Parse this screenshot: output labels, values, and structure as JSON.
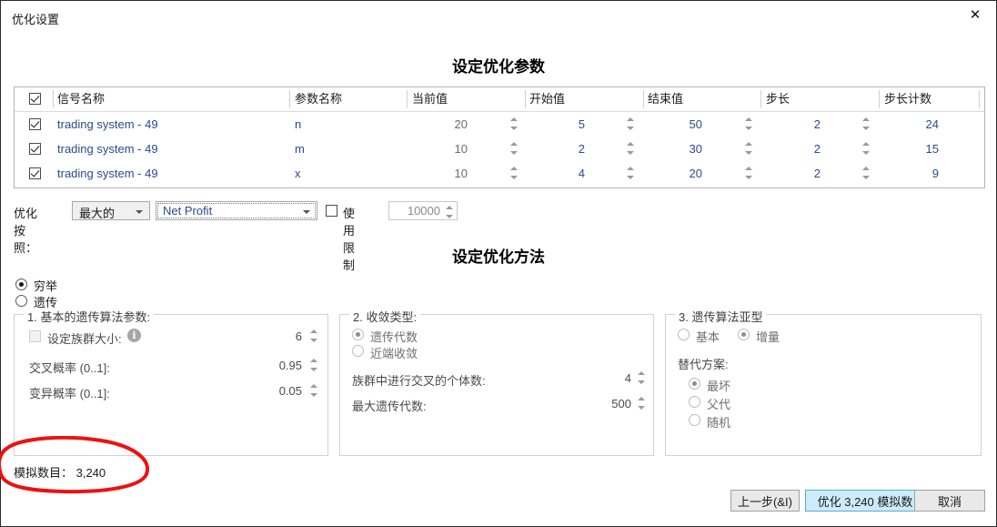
{
  "window": {
    "title": "优化设置",
    "close_icon": "close-icon"
  },
  "headings": {
    "params": "设定优化参数",
    "method": "设定优化方法"
  },
  "grid": {
    "columns": [
      "信号名称",
      "参数名称",
      "当前值",
      "开始值",
      "结束值",
      "步长",
      "步长计数"
    ],
    "rows": [
      {
        "checked": true,
        "signal": "trading system - 49",
        "param": "n",
        "current": "20",
        "start": "5",
        "end": "50",
        "step": "2",
        "count": "24"
      },
      {
        "checked": true,
        "signal": "trading system - 49",
        "param": "m",
        "current": "10",
        "start": "2",
        "end": "30",
        "step": "2",
        "count": "15"
      },
      {
        "checked": true,
        "signal": "trading system - 49",
        "param": "x",
        "current": "10",
        "start": "4",
        "end": "20",
        "step": "2",
        "count": "9"
      }
    ]
  },
  "optimize_by": {
    "label": "优化按照：",
    "direction": "最大的",
    "metric": "Net Profit",
    "limit_label": "使用限制",
    "limit_checked": false,
    "limit_value": "10000"
  },
  "method": {
    "exhaustive": "穷举",
    "genetic": "遗传",
    "selected": "穷举"
  },
  "group1": {
    "title": "1. 基本的遗传算法参数:",
    "population_label": "设定族群大小:",
    "population_value": "6",
    "info_icon": "info-icon",
    "crossover_label": "交叉概率 (0..1]:",
    "crossover_value": "0.95",
    "mutation_label": "变异概率 (0..1]:",
    "mutation_value": "0.05"
  },
  "group2": {
    "title": "2. 收敛类型:",
    "radio_generations": "遗传代数",
    "radio_proximity": "近端收敛",
    "selected": "遗传代数",
    "crossover_count_label": "族群中进行交叉的个体数:",
    "crossover_count_value": "4",
    "max_generations_label": "最大遗传代数:",
    "max_generations_value": "500"
  },
  "group3": {
    "title": "3. 遗传算法亚型",
    "radio_basic": "基本",
    "radio_incremental": "增量",
    "selected_subtype": "增量",
    "replacement_label": "替代方案:",
    "replacement_worst": "最坏",
    "replacement_parent": "父代",
    "replacement_random": "随机",
    "selected_replacement": "最坏"
  },
  "footer": {
    "count_label": "模拟数目：",
    "count_value": "3,240",
    "count_text": "模拟数目：  3,240",
    "back_button": "上一步(&I)",
    "optimize_button": "优化 3,240 模拟数",
    "cancel_button": "取消"
  },
  "annotation": {
    "color": "#ee1111",
    "shape": "hand-drawn-ellipse"
  }
}
